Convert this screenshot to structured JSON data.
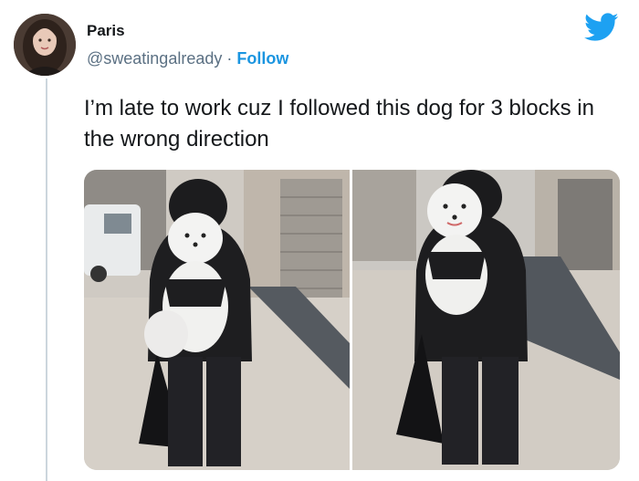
{
  "author": {
    "name": "Paris",
    "handle": "@sweatingalready",
    "separator": "·",
    "follow_label": "Follow"
  },
  "tweet": {
    "text": "I’m late to work cuz I followed this dog for 3 blocks in the wrong direction"
  },
  "icons": {
    "brand": "twitter-bird-icon"
  },
  "colors": {
    "link": "#1b95e0",
    "brand": "#1da1f2",
    "text": "#14171a",
    "secondary": "#5b7083"
  }
}
